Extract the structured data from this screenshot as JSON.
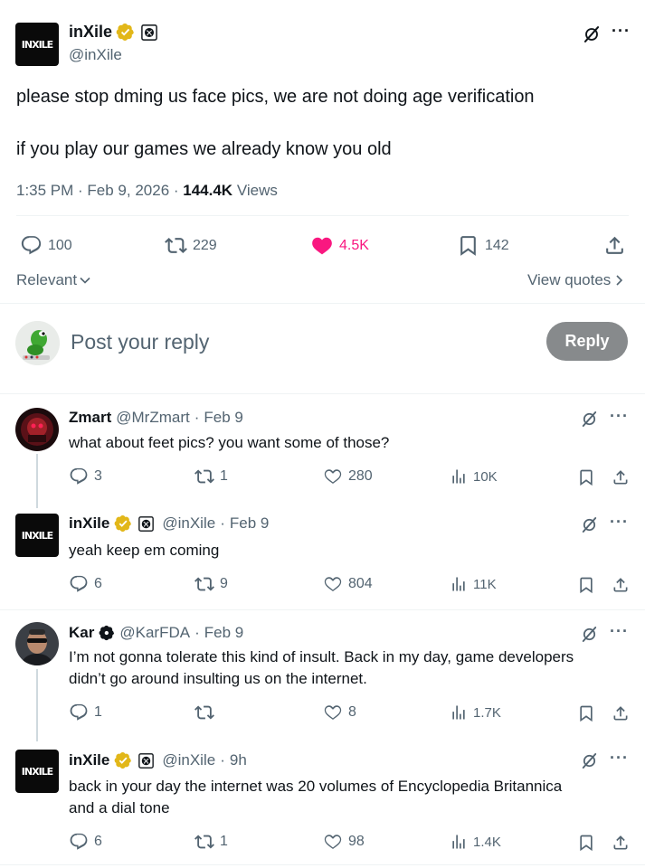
{
  "main": {
    "author_name": "inXile",
    "author_handle": "@inXile",
    "avatar_text": "INXILE",
    "text_line1": "please stop dming us face pics, we are not doing age verification",
    "text_line2": "if you play our games we already know you old",
    "time": "1:35 PM · Feb 9, 2026 · ",
    "views_count": "144.4K",
    "views_label": " Views",
    "stats": {
      "replies": "100",
      "reposts": "229",
      "likes": "4.5K",
      "bookmarks": "142"
    },
    "liked": true
  },
  "filters": {
    "sort_label": "Relevant",
    "quotes_label": "View quotes"
  },
  "composer": {
    "placeholder": "Post your reply",
    "reply_button": "Reply"
  },
  "replies": [
    {
      "name": "Zmart",
      "handle": "@MrZmart",
      "sep": "·",
      "date": "Feb 9",
      "text_lines": [
        "what about feet pics? you want some of those?"
      ],
      "replies": "3",
      "reposts": "1",
      "likes": "280",
      "views": "10K"
    },
    {
      "name": "inXile",
      "handle": "@inXile",
      "sep": "·",
      "date": "Feb 9",
      "text_lines": [
        "yeah keep em coming"
      ],
      "replies": "6",
      "reposts": "9",
      "likes": "804",
      "views": "11K"
    },
    {
      "name": "Kar",
      "handle": "@KarFDA",
      "sep": "·",
      "date": "Feb 9",
      "text_lines": [
        "I’m not gonna tolerate this kind of insult. Back in my day, game developers",
        "didn’t go around insulting us on the internet."
      ],
      "replies": "1",
      "reposts": "",
      "likes": "8",
      "views": "1.7K"
    },
    {
      "name": "inXile",
      "handle": "@inXile",
      "sep": "·",
      "date": "9h",
      "text_lines": [
        "back in your day the internet was 20 volumes of Encyclopedia Britannica",
        "and a dial tone"
      ],
      "replies": "6",
      "reposts": "1",
      "likes": "98",
      "views": "1.4K"
    }
  ],
  "colors": {
    "like": "#f91880",
    "text": "#0f1419",
    "muted": "#536471",
    "gold": "#e2b719",
    "reply_btn": "#878a8c"
  },
  "icons": [
    "grok-icon",
    "more-icon",
    "reply-icon",
    "repost-icon",
    "heart-icon",
    "bookmark-icon",
    "share-icon",
    "views-icon",
    "gold-badge-icon",
    "affiliate-xbox-icon",
    "chevron-down-icon",
    "chevron-right-icon"
  ]
}
